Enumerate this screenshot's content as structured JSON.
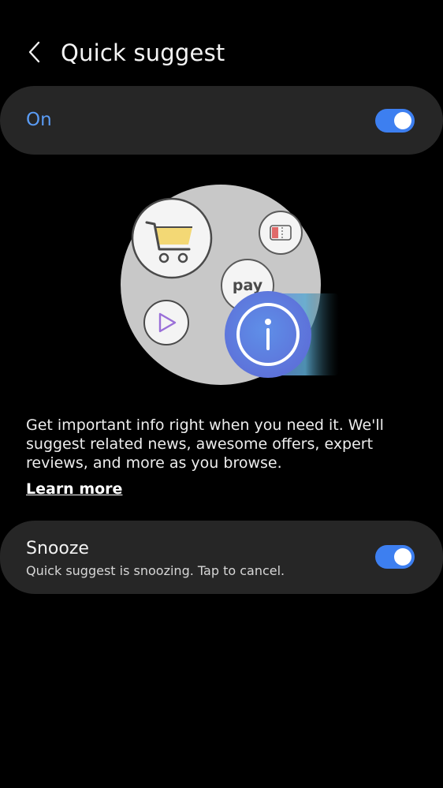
{
  "header": {
    "title": "Quick suggest",
    "back_icon": "back-arrow-icon"
  },
  "master_switch": {
    "label": "On",
    "state": true,
    "label_color": "#5a9cf5",
    "toggle_color": "#3d7ff0"
  },
  "illustration": {
    "icons": [
      "shopping-cart-icon",
      "ticket-icon",
      "pay-icon",
      "play-icon",
      "info-icon"
    ],
    "pay_text": "pay"
  },
  "description": {
    "text": "Get important info right when you need it. We'll suggest related news, awesome offers, expert reviews, and more as you browse.",
    "learn_more": "Learn more"
  },
  "snooze": {
    "title": "Snooze",
    "subtitle": "Quick suggest is snoozing. Tap to cancel.",
    "state": true
  }
}
